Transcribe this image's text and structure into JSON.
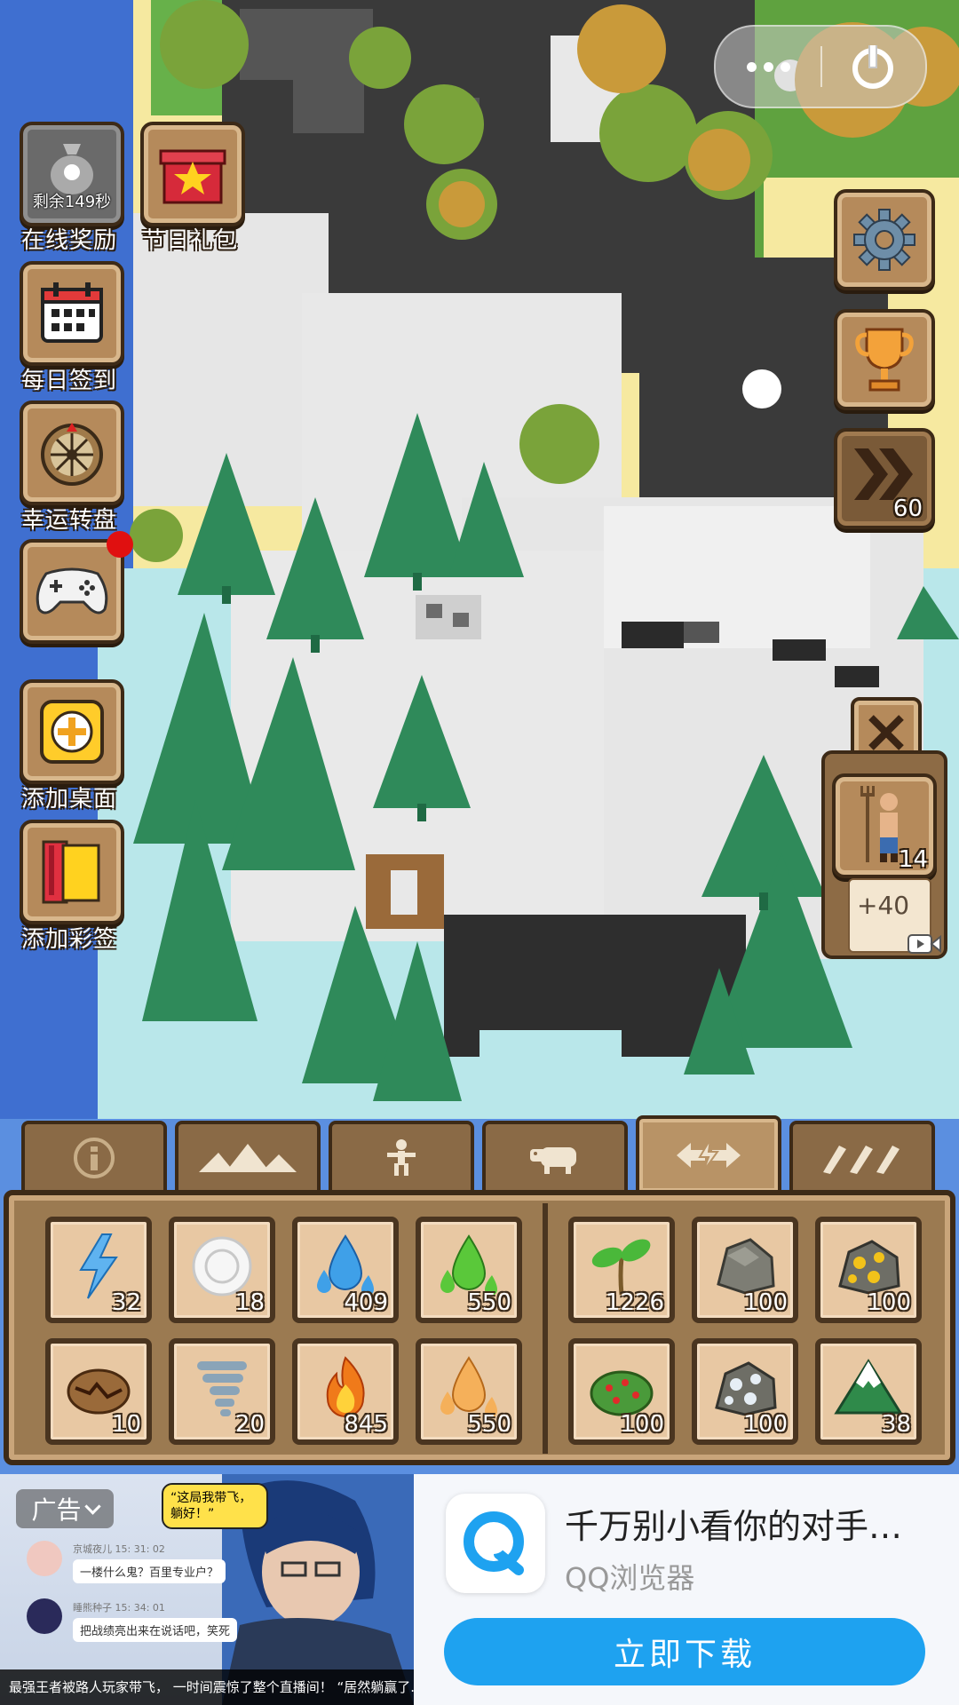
{
  "left_menu": {
    "online_reward": {
      "label": "在线奖励",
      "timer": "剩余149秒"
    },
    "holiday_gift": {
      "label": "节日礼包"
    },
    "daily_checkin": {
      "label": "每日签到"
    },
    "lucky_wheel": {
      "label": "幸运转盘"
    },
    "games": {
      "label": ""
    },
    "add_desktop": {
      "label": "添加桌面"
    },
    "add_bookmark": {
      "label": "添加彩签"
    }
  },
  "right_menu": {
    "speed_value": "60"
  },
  "side_panel": {
    "villager_count": "14",
    "bonus": "+40"
  },
  "toolbar": {
    "tabs": [
      "info-icon",
      "terrain-icon",
      "human-icon",
      "animal-icon",
      "powers-icon",
      "tools-icon"
    ],
    "active_tab": 4
  },
  "powers": {
    "row1": [
      {
        "name": "lightning-icon",
        "count": "32"
      },
      {
        "name": "blizzard-icon",
        "count": "18"
      },
      {
        "name": "rain-icon",
        "count": "409"
      },
      {
        "name": "acid-rain-icon",
        "count": "550"
      },
      {
        "name": "sprout-icon",
        "count": "1226"
      },
      {
        "name": "stone-icon",
        "count": "100"
      },
      {
        "name": "gold-ore-icon",
        "count": "100"
      }
    ],
    "row2": [
      {
        "name": "earthquake-icon",
        "count": "10"
      },
      {
        "name": "tornado-icon",
        "count": "20"
      },
      {
        "name": "fire-icon",
        "count": "845"
      },
      {
        "name": "lava-rain-icon",
        "count": "550"
      },
      {
        "name": "berry-bush-icon",
        "count": "100"
      },
      {
        "name": "silver-ore-icon",
        "count": "100"
      },
      {
        "name": "mountain-icon",
        "count": "38"
      }
    ]
  },
  "ad": {
    "tag": "广告",
    "bubble": "“这局我带飞，躺好！”",
    "chat1_name": "京城夜儿  15: 31: 02",
    "chat1_msg": "一楼什么鬼？百里专业户？",
    "chat2_name": "睡熊种子  15: 34: 01",
    "chat2_msg": "把战绩亮出来在说话吧，笑死",
    "caption": "最强王者被路人玩家带飞， 一时间震惊了整个直播间！ “居然躺赢了...”",
    "title": "千万别小看你的对手…",
    "subtitle": "QQ浏览器",
    "button": "立即下载"
  },
  "colors": {
    "wood": "#b58a5b",
    "wood_dark": "#3d2a17",
    "slot": "#e8c8a3",
    "ad_button": "#1ea2f0"
  }
}
